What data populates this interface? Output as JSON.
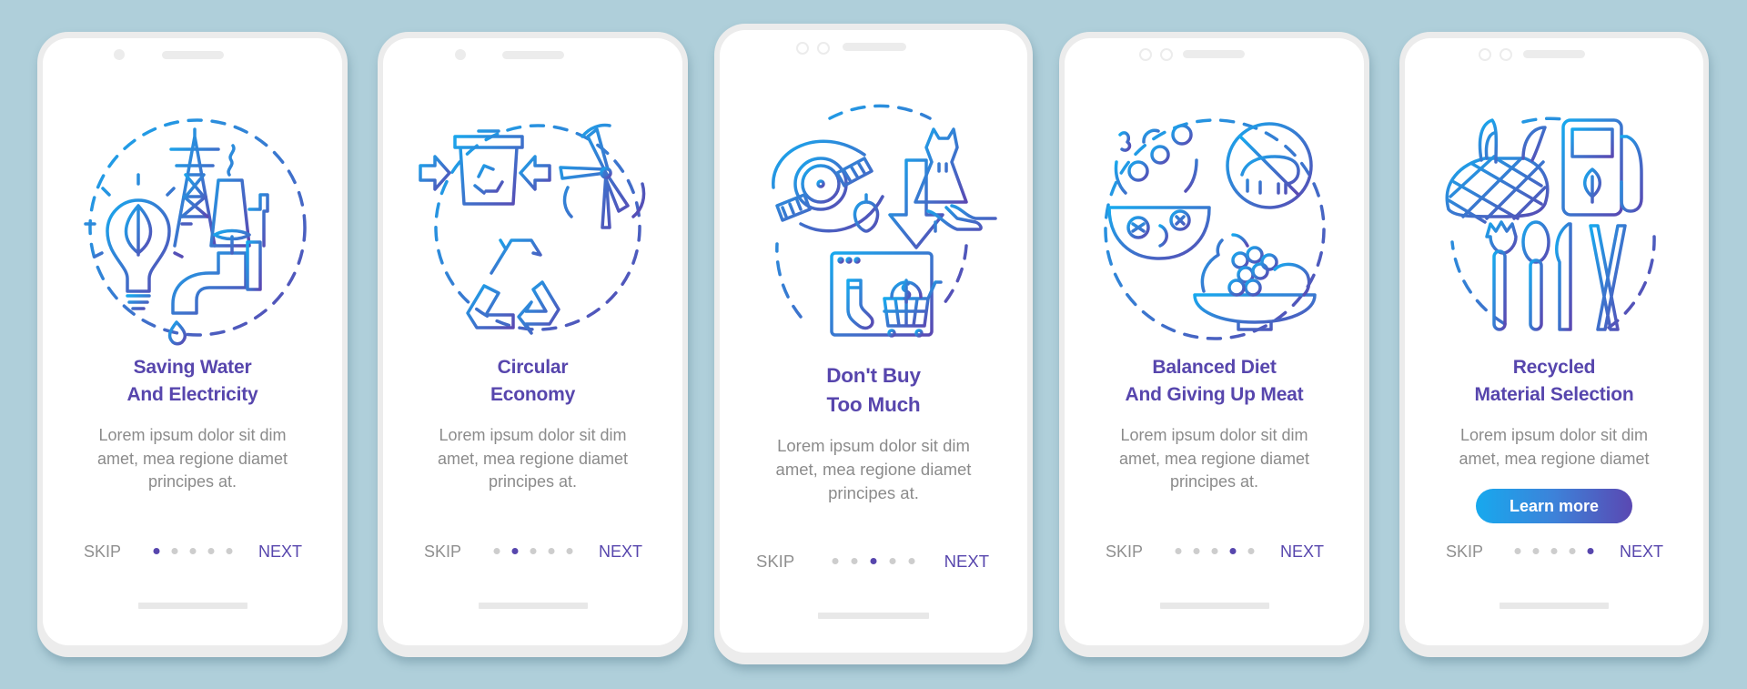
{
  "colors": {
    "background": "#afcfda",
    "accent": "#5746ad",
    "icon_gradient_start": "#1aa6ea",
    "icon_gradient_end": "#5a48b2",
    "muted_text": "#8b8b8b"
  },
  "screens": [
    {
      "title_lines": [
        "Saving Water",
        "And Electricity"
      ],
      "body_lines": [
        "Lorem ipsum dolor sit dim",
        "amet, mea regione diamet",
        "principes at."
      ],
      "skip_label": "SKIP",
      "next_label": "NEXT",
      "active_page": 1,
      "page_count": 5,
      "illustration": [
        "light-bulb-leaf-icon",
        "power-tower-icon",
        "power-plant-icon",
        "water-tap-icon",
        "water-drop-icon"
      ]
    },
    {
      "title_lines": [
        "Circular",
        "Economy"
      ],
      "body_lines": [
        "Lorem ipsum dolor sit dim",
        "amet, mea regione diamet",
        "principes at."
      ],
      "skip_label": "SKIP",
      "next_label": "NEXT",
      "active_page": 2,
      "page_count": 5,
      "illustration": [
        "recycle-bin-icon",
        "arrows-in-icon",
        "wind-turbine-icon",
        "recycle-arrows-icon"
      ]
    },
    {
      "title_lines": [
        "Don't Buy",
        "Too Much"
      ],
      "body_lines": [
        "Lorem ipsum dolor sit dim",
        "amet, mea regione diamet",
        "principes at."
      ],
      "skip_label": "SKIP",
      "next_label": "NEXT",
      "active_page": 3,
      "page_count": 5,
      "illustration": [
        "wristwatch-icon",
        "pendant-icon",
        "down-arrow-icon",
        "dress-icon",
        "high-heels-icon",
        "browser-window-icon",
        "sock-icon",
        "shopping-cart-icon",
        "dollar-coin-icon"
      ]
    },
    {
      "title_lines": [
        "Balanced Diet",
        "And Giving Up Meat"
      ],
      "body_lines": [
        "Lorem ipsum dolor sit dim",
        "amet, mea regione diamet",
        "principes at."
      ],
      "skip_label": "SKIP",
      "next_label": "NEXT",
      "active_page": 4,
      "page_count": 5,
      "illustration": [
        "salad-bowl-icon",
        "no-meat-icon",
        "fruit-bowl-icon"
      ]
    },
    {
      "title_lines": [
        "Recycled",
        "Material Selection"
      ],
      "body_lines": [
        "Lorem ipsum dolor sit dim",
        "amet, mea regione diamet"
      ],
      "button_label": "Learn more",
      "skip_label": "SKIP",
      "next_label": "NEXT",
      "active_page": 5,
      "page_count": 5,
      "illustration": [
        "mesh-bag-icon",
        "eco-fuel-pump-icon",
        "fork-icon",
        "spoon-icon",
        "knife-icon",
        "chopsticks-icon"
      ]
    }
  ]
}
